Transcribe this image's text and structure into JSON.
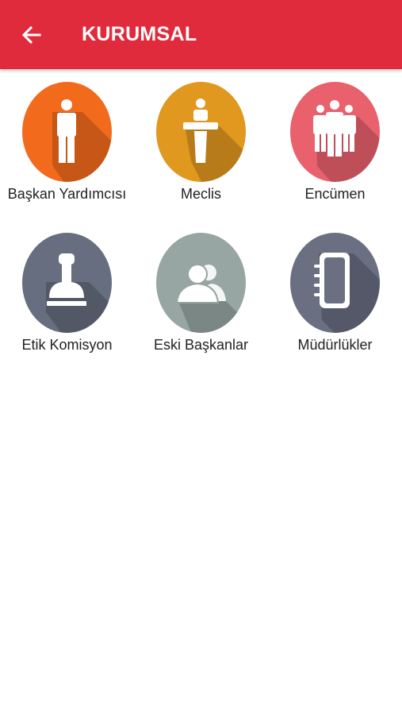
{
  "app_bar": {
    "title": "KURUMSAL",
    "back_icon": "arrow-left-icon",
    "background": "#E02B3C"
  },
  "menu": [
    {
      "label": "Başkan Yardımcısı",
      "icon": "person-icon",
      "color": "#F26B1D"
    },
    {
      "label": "Meclis",
      "icon": "podium-speaker-icon",
      "color": "#E0981F"
    },
    {
      "label": "Encümen",
      "icon": "group-icon",
      "color": "#E8616D"
    },
    {
      "label": "Etik Komisyon",
      "icon": "stamp-icon",
      "color": "#676E80"
    },
    {
      "label": "Eski Başkanlar",
      "icon": "users-icon",
      "color": "#97A5A3"
    },
    {
      "label": "Müdürlükler",
      "icon": "notebook-icon",
      "color": "#6A6F82"
    }
  ]
}
